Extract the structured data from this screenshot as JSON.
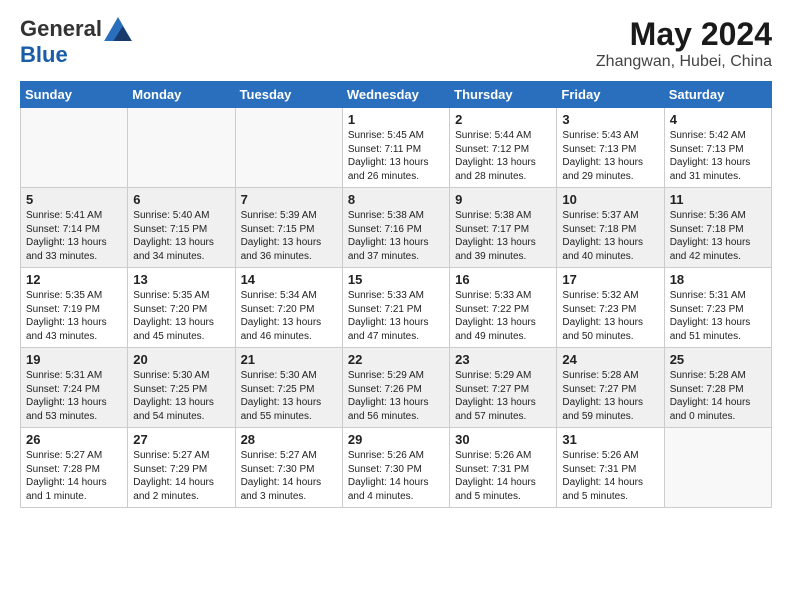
{
  "header": {
    "logo": {
      "general": "General",
      "blue": "Blue"
    },
    "title": "May 2024",
    "location": "Zhangwan, Hubei, China"
  },
  "days_of_week": [
    "Sunday",
    "Monday",
    "Tuesday",
    "Wednesday",
    "Thursday",
    "Friday",
    "Saturday"
  ],
  "weeks": [
    [
      {
        "num": "",
        "info": ""
      },
      {
        "num": "",
        "info": ""
      },
      {
        "num": "",
        "info": ""
      },
      {
        "num": "1",
        "info": "Sunrise: 5:45 AM\nSunset: 7:11 PM\nDaylight: 13 hours\nand 26 minutes."
      },
      {
        "num": "2",
        "info": "Sunrise: 5:44 AM\nSunset: 7:12 PM\nDaylight: 13 hours\nand 28 minutes."
      },
      {
        "num": "3",
        "info": "Sunrise: 5:43 AM\nSunset: 7:13 PM\nDaylight: 13 hours\nand 29 minutes."
      },
      {
        "num": "4",
        "info": "Sunrise: 5:42 AM\nSunset: 7:13 PM\nDaylight: 13 hours\nand 31 minutes."
      }
    ],
    [
      {
        "num": "5",
        "info": "Sunrise: 5:41 AM\nSunset: 7:14 PM\nDaylight: 13 hours\nand 33 minutes."
      },
      {
        "num": "6",
        "info": "Sunrise: 5:40 AM\nSunset: 7:15 PM\nDaylight: 13 hours\nand 34 minutes."
      },
      {
        "num": "7",
        "info": "Sunrise: 5:39 AM\nSunset: 7:15 PM\nDaylight: 13 hours\nand 36 minutes."
      },
      {
        "num": "8",
        "info": "Sunrise: 5:38 AM\nSunset: 7:16 PM\nDaylight: 13 hours\nand 37 minutes."
      },
      {
        "num": "9",
        "info": "Sunrise: 5:38 AM\nSunset: 7:17 PM\nDaylight: 13 hours\nand 39 minutes."
      },
      {
        "num": "10",
        "info": "Sunrise: 5:37 AM\nSunset: 7:18 PM\nDaylight: 13 hours\nand 40 minutes."
      },
      {
        "num": "11",
        "info": "Sunrise: 5:36 AM\nSunset: 7:18 PM\nDaylight: 13 hours\nand 42 minutes."
      }
    ],
    [
      {
        "num": "12",
        "info": "Sunrise: 5:35 AM\nSunset: 7:19 PM\nDaylight: 13 hours\nand 43 minutes."
      },
      {
        "num": "13",
        "info": "Sunrise: 5:35 AM\nSunset: 7:20 PM\nDaylight: 13 hours\nand 45 minutes."
      },
      {
        "num": "14",
        "info": "Sunrise: 5:34 AM\nSunset: 7:20 PM\nDaylight: 13 hours\nand 46 minutes."
      },
      {
        "num": "15",
        "info": "Sunrise: 5:33 AM\nSunset: 7:21 PM\nDaylight: 13 hours\nand 47 minutes."
      },
      {
        "num": "16",
        "info": "Sunrise: 5:33 AM\nSunset: 7:22 PM\nDaylight: 13 hours\nand 49 minutes."
      },
      {
        "num": "17",
        "info": "Sunrise: 5:32 AM\nSunset: 7:23 PM\nDaylight: 13 hours\nand 50 minutes."
      },
      {
        "num": "18",
        "info": "Sunrise: 5:31 AM\nSunset: 7:23 PM\nDaylight: 13 hours\nand 51 minutes."
      }
    ],
    [
      {
        "num": "19",
        "info": "Sunrise: 5:31 AM\nSunset: 7:24 PM\nDaylight: 13 hours\nand 53 minutes."
      },
      {
        "num": "20",
        "info": "Sunrise: 5:30 AM\nSunset: 7:25 PM\nDaylight: 13 hours\nand 54 minutes."
      },
      {
        "num": "21",
        "info": "Sunrise: 5:30 AM\nSunset: 7:25 PM\nDaylight: 13 hours\nand 55 minutes."
      },
      {
        "num": "22",
        "info": "Sunrise: 5:29 AM\nSunset: 7:26 PM\nDaylight: 13 hours\nand 56 minutes."
      },
      {
        "num": "23",
        "info": "Sunrise: 5:29 AM\nSunset: 7:27 PM\nDaylight: 13 hours\nand 57 minutes."
      },
      {
        "num": "24",
        "info": "Sunrise: 5:28 AM\nSunset: 7:27 PM\nDaylight: 13 hours\nand 59 minutes."
      },
      {
        "num": "25",
        "info": "Sunrise: 5:28 AM\nSunset: 7:28 PM\nDaylight: 14 hours\nand 0 minutes."
      }
    ],
    [
      {
        "num": "26",
        "info": "Sunrise: 5:27 AM\nSunset: 7:28 PM\nDaylight: 14 hours\nand 1 minute."
      },
      {
        "num": "27",
        "info": "Sunrise: 5:27 AM\nSunset: 7:29 PM\nDaylight: 14 hours\nand 2 minutes."
      },
      {
        "num": "28",
        "info": "Sunrise: 5:27 AM\nSunset: 7:30 PM\nDaylight: 14 hours\nand 3 minutes."
      },
      {
        "num": "29",
        "info": "Sunrise: 5:26 AM\nSunset: 7:30 PM\nDaylight: 14 hours\nand 4 minutes."
      },
      {
        "num": "30",
        "info": "Sunrise: 5:26 AM\nSunset: 7:31 PM\nDaylight: 14 hours\nand 5 minutes."
      },
      {
        "num": "31",
        "info": "Sunrise: 5:26 AM\nSunset: 7:31 PM\nDaylight: 14 hours\nand 5 minutes."
      },
      {
        "num": "",
        "info": ""
      }
    ]
  ]
}
